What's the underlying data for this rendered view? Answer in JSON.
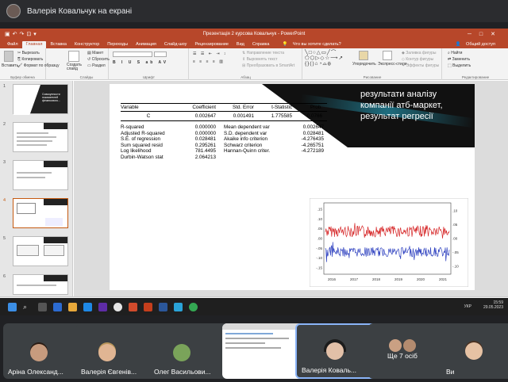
{
  "meet": {
    "presenter_title": "Валерія Ковальчук на екрані"
  },
  "powerpoint": {
    "window_title": "Презентація 2 курсова Ковальчук  -  PowerPoint",
    "tabs": [
      "Файл",
      "Главная",
      "Вставка",
      "Конструктор",
      "Переходы",
      "Анимация",
      "Слайд-шоу",
      "Рецензирование",
      "Вид",
      "Справка"
    ],
    "active_tab": "Главная",
    "tell_me": "Что вы хотите сделать?",
    "share": "Общий доступ",
    "ribbon": {
      "paste": "Вставить",
      "cut": "Вырезать",
      "copy": "Копировать",
      "format_painter": "Формат по образцу",
      "clipboard": "Буфер обмена",
      "new_slide": "Создать слайд",
      "layout": "Макет",
      "reset": "Сбросить",
      "section": "Раздел",
      "slides": "Слайды",
      "font": "Шрифт",
      "text_direction": "Направление текста",
      "align_text": "Выровнять текст",
      "smartart": "Преобразовать в SmartArt",
      "paragraph": "Абзац",
      "arrange": "Упорядочить",
      "quick_styles": "Экспресс-стили",
      "shape_fill": "Заливка фигуры",
      "shape_outline": "Контур фигуры",
      "shape_effects": "Эффекты фигуры",
      "drawing": "Рисование",
      "find": "Найти",
      "replace": "Заменить",
      "select": "Выделить",
      "editing": "Редактирование"
    },
    "thumbnail_numbers": [
      "1",
      "2",
      "3",
      "4",
      "5",
      "6"
    ],
    "thumb1_text": "Совокупности показателей фінансового...",
    "status": {
      "slide_info": "Слайд 4 из 12",
      "language": "русский",
      "notes": "Заметки",
      "comments": "Примечания"
    }
  },
  "slide": {
    "title": "результати аналізу компанії атб-маркет, результат регресії",
    "table": {
      "headers": [
        "Variable",
        "Coefficient",
        "Std. Error",
        "t-Statistic",
        "Prob."
      ],
      "row": [
        "C",
        "0.002647",
        "0.001491",
        "1.775585",
        "0.0766"
      ],
      "stats": [
        [
          "R-squared",
          "0.000000",
          "Mean dependent var",
          "0.002647"
        ],
        [
          "Adjusted R-squared",
          "0.000000",
          "S.D. dependent var",
          "0.028481"
        ],
        [
          "S.E. of regression",
          "0.028481",
          "Akaike info criterion",
          "-4.276435"
        ],
        [
          "Sum squared resid",
          "0.295261",
          "Schwarz criterion",
          "-4.265751"
        ],
        [
          "Log likelihood",
          "781.4495",
          "Hannan-Quinn criter.",
          "-4.272189"
        ],
        [
          "Durbin-Watson stat",
          "2.064213",
          "",
          ""
        ]
      ]
    },
    "chart_data": {
      "type": "line",
      "x_ticks": [
        "2016",
        "2017",
        "2018",
        "2019",
        "2020",
        "2021"
      ],
      "y_left_ticks": [
        ".15",
        ".10",
        ".05",
        ".00",
        "-.05",
        "-.10",
        "-.15"
      ],
      "y_right_ticks": [
        ".10",
        ".05",
        ".00",
        "-.05",
        "-.10"
      ],
      "series": [
        {
          "color": "#d62728"
        },
        {
          "color": "#2c3fbf"
        }
      ]
    }
  },
  "taskbar": {
    "time": "15:59",
    "date": "29.05.2023",
    "lang": "УКР"
  },
  "participants": [
    {
      "name": "Аріна Олександ..."
    },
    {
      "name": "Валерія Євгенів..."
    },
    {
      "name": "Олег Васильови..."
    },
    {
      "name": ""
    },
    {
      "name": "Валерія Коваль..."
    },
    {
      "name": "Ще 7 осіб"
    },
    {
      "name": "Ви"
    }
  ]
}
